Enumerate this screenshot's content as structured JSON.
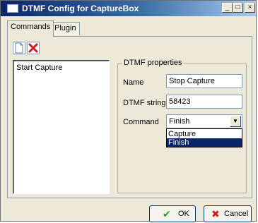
{
  "window": {
    "title": "DTMF Config for CaptureBox",
    "controls": {
      "minimize": "_",
      "maximize": "□",
      "close": "×"
    }
  },
  "tabs": [
    {
      "label": "Commands",
      "active": true
    },
    {
      "label": "Plugin",
      "active": false
    }
  ],
  "toolbar": {
    "new_icon": "document-icon",
    "delete_icon": "red-x-icon"
  },
  "commands_list": {
    "items": [
      "Start Capture"
    ]
  },
  "dtmf_properties": {
    "legend": "DTMF properties",
    "name_label": "Name",
    "name_value": "Stop Capture",
    "dtmf_label": "DTMF string",
    "dtmf_value": "58423",
    "command_label": "Command",
    "command_value": "Finish",
    "command_options": [
      "Capture",
      "Finish"
    ],
    "command_highlighted": "Finish"
  },
  "footer": {
    "ok_label": "OK",
    "cancel_label": "Cancel",
    "ok_icon": "green-check-icon",
    "cancel_icon": "red-x-icon"
  },
  "colors": {
    "title_start": "#0a246a",
    "title_end": "#a6caf0",
    "selection": "#0a246a"
  }
}
